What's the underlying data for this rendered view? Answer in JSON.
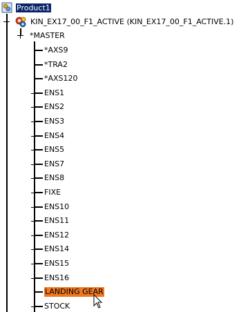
{
  "tree": {
    "root": {
      "label": "Product1"
    },
    "product": {
      "label": "KIN_EX17_00_F1_ACTIVE (KIN_EX17_00_F1_ACTIVE.1)"
    },
    "master": {
      "label": "*MASTER"
    },
    "children": [
      {
        "label": "*AXS9",
        "expandable": false
      },
      {
        "label": "*TRA2",
        "expandable": false
      },
      {
        "label": "*AXS120",
        "expandable": false
      },
      {
        "label": "ENS1",
        "expandable": true
      },
      {
        "label": "ENS2",
        "expandable": true
      },
      {
        "label": "ENS3",
        "expandable": true
      },
      {
        "label": "ENS4",
        "expandable": true
      },
      {
        "label": "ENS5",
        "expandable": true
      },
      {
        "label": "ENS7",
        "expandable": true
      },
      {
        "label": "ENS8",
        "expandable": true
      },
      {
        "label": "FIXE",
        "expandable": true
      },
      {
        "label": "ENS10",
        "expandable": true
      },
      {
        "label": "ENS11",
        "expandable": true
      },
      {
        "label": "ENS12",
        "expandable": true
      },
      {
        "label": "ENS14",
        "expandable": true
      },
      {
        "label": "ENS15",
        "expandable": true
      },
      {
        "label": "ENS16",
        "expandable": true
      },
      {
        "label": "LANDING GEAR",
        "expandable": false,
        "highlighted": true
      },
      {
        "label": "STOCK",
        "expandable": true
      }
    ]
  },
  "colors": {
    "root_selection": "#0a246a",
    "highlight": "#f07820"
  },
  "icons": {
    "root": "product-icon",
    "product": "component-gears-icon",
    "cursor": "mouse-pointer-icon"
  }
}
